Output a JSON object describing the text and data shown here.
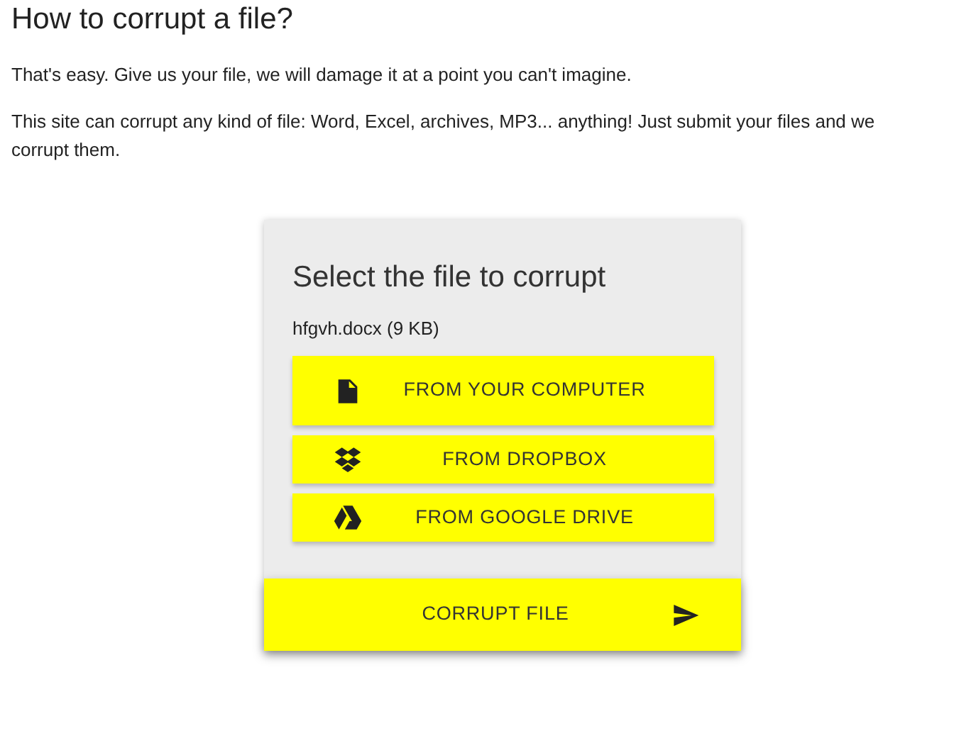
{
  "heading": "How to corrupt a file?",
  "paragraphs": [
    {
      "lines": [
        "That's easy. Give us your file, we will damage it at a point you can't imagine."
      ]
    },
    {
      "lines": [
        "This site can corrupt any kind of file: Word, Excel, archives, MP3... anything! Just submit your files and we",
        "corrupt them."
      ]
    }
  ],
  "card": {
    "title": "Select the file to corrupt",
    "file": "hfgvh.docx (9 KB)",
    "sources": [
      {
        "kind": "computer",
        "label": "FROM YOUR COMPUTER"
      },
      {
        "kind": "dropbox",
        "label": "FROM DROPBOX"
      },
      {
        "kind": "drive",
        "label": "FROM GOOGLE DRIVE"
      }
    ],
    "submit": {
      "label": "CORRUPT FILE"
    }
  }
}
